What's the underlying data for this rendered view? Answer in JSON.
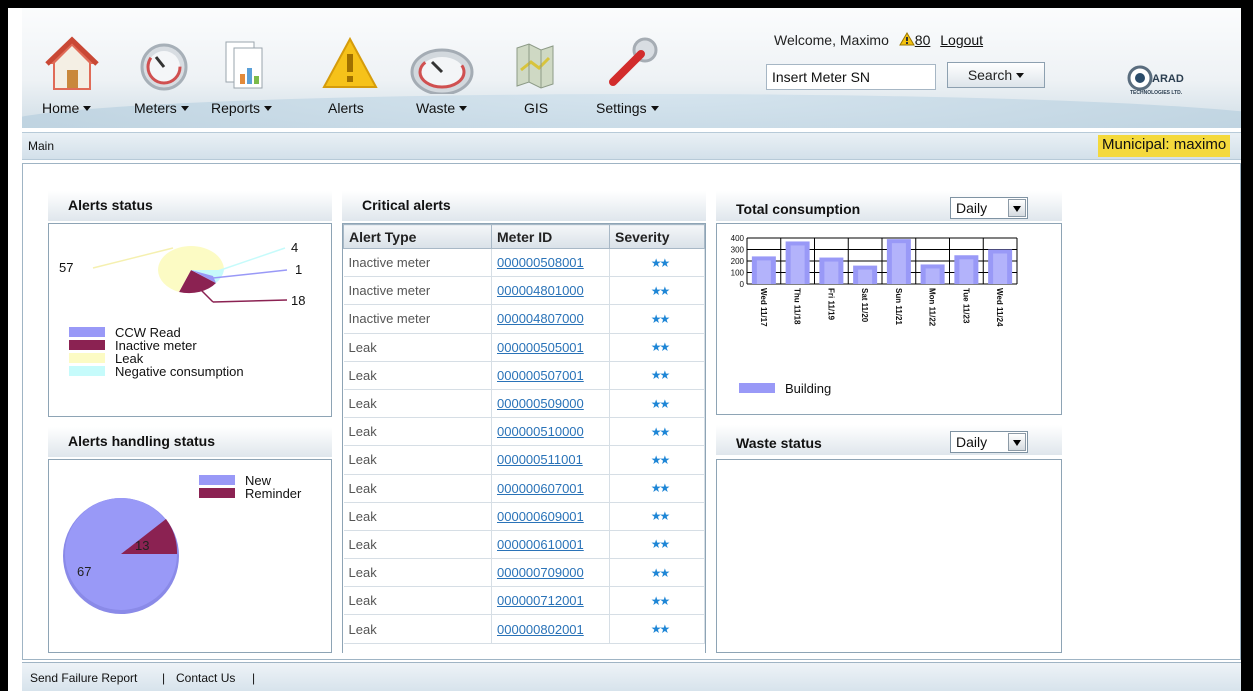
{
  "nav": [
    {
      "label": "Home",
      "caret": true,
      "icon": "home-icon"
    },
    {
      "label": "Meters",
      "caret": true,
      "icon": "gauge-icon"
    },
    {
      "label": "Reports",
      "caret": true,
      "icon": "reports-icon"
    },
    {
      "label": "Alerts",
      "caret": false,
      "icon": "alert-icon"
    },
    {
      "label": "Waste",
      "caret": true,
      "icon": "waste-gauge-icon"
    },
    {
      "label": "GIS",
      "caret": false,
      "icon": "map-icon"
    },
    {
      "label": "Settings",
      "caret": true,
      "icon": "wrench-icon"
    }
  ],
  "header": {
    "welcome": "Welcome, Maximo",
    "alert_count": "80",
    "logout": "Logout",
    "meter_input_value": "Insert Meter SN",
    "search_label": "Search",
    "logo_text": "ARAD",
    "logo_sub": "TECHNOLOGIES LTD."
  },
  "breadcrumb": "Main",
  "municipal": "Municipal: maximo",
  "alerts_status": {
    "title": "Alerts status",
    "legend": [
      {
        "label": "CCW Read",
        "color": "#9999f7"
      },
      {
        "label": "Inactive meter",
        "color": "#8b2252"
      },
      {
        "label": "Leak",
        "color": "#fcfbc4"
      },
      {
        "label": "Negative consumption",
        "color": "#c6fbfb"
      }
    ],
    "values": {
      "ccw": "1",
      "inactive": "18",
      "leak": "57",
      "negative": "4"
    }
  },
  "handling": {
    "title": "Alerts handling status",
    "legend": [
      {
        "label": "New",
        "color": "#9999f7"
      },
      {
        "label": "Reminder",
        "color": "#8b2252"
      }
    ],
    "new_value": "67",
    "reminder_value": "13"
  },
  "critical": {
    "title": "Critical alerts",
    "columns": [
      "Alert Type",
      "Meter ID",
      "Severity"
    ],
    "rows": [
      [
        "Inactive meter",
        "000000508001"
      ],
      [
        "Inactive meter",
        "000004801000"
      ],
      [
        "Inactive meter",
        "000004807000"
      ],
      [
        "Leak",
        "000000505001"
      ],
      [
        "Leak",
        "000000507001"
      ],
      [
        "Leak",
        "000000509000"
      ],
      [
        "Leak",
        "000000510000"
      ],
      [
        "Leak",
        "000000511001"
      ],
      [
        "Leak",
        "000000607001"
      ],
      [
        "Leak",
        "000000609001"
      ],
      [
        "Leak",
        "000000610001"
      ],
      [
        "Leak",
        "000000709000"
      ],
      [
        "Leak",
        "000000712001"
      ],
      [
        "Leak",
        "000000802001"
      ]
    ],
    "severity_glyph": "★★"
  },
  "consumption": {
    "title": "Total consumption",
    "period": "Daily",
    "legend": "Building"
  },
  "chart_data": {
    "type": "bar",
    "categories": [
      "Wed 11/17",
      "Thu 11/18",
      "Fri 11/19",
      "Sat 11/20",
      "Sun 11/21",
      "Mon 11/22",
      "Tue 11/23",
      "Wed 11/24"
    ],
    "series": [
      {
        "name": "Building",
        "values": [
          240,
          370,
          230,
          160,
          390,
          170,
          250,
          300
        ]
      }
    ],
    "ylim": [
      0,
      400
    ],
    "yticks": [
      "400",
      "300",
      "200",
      "100",
      "0"
    ],
    "bar_color": "#9999f7"
  },
  "waste": {
    "title": "Waste status",
    "period": "Daily"
  },
  "footer": [
    "Send Failure Report",
    "Contact Us"
  ]
}
